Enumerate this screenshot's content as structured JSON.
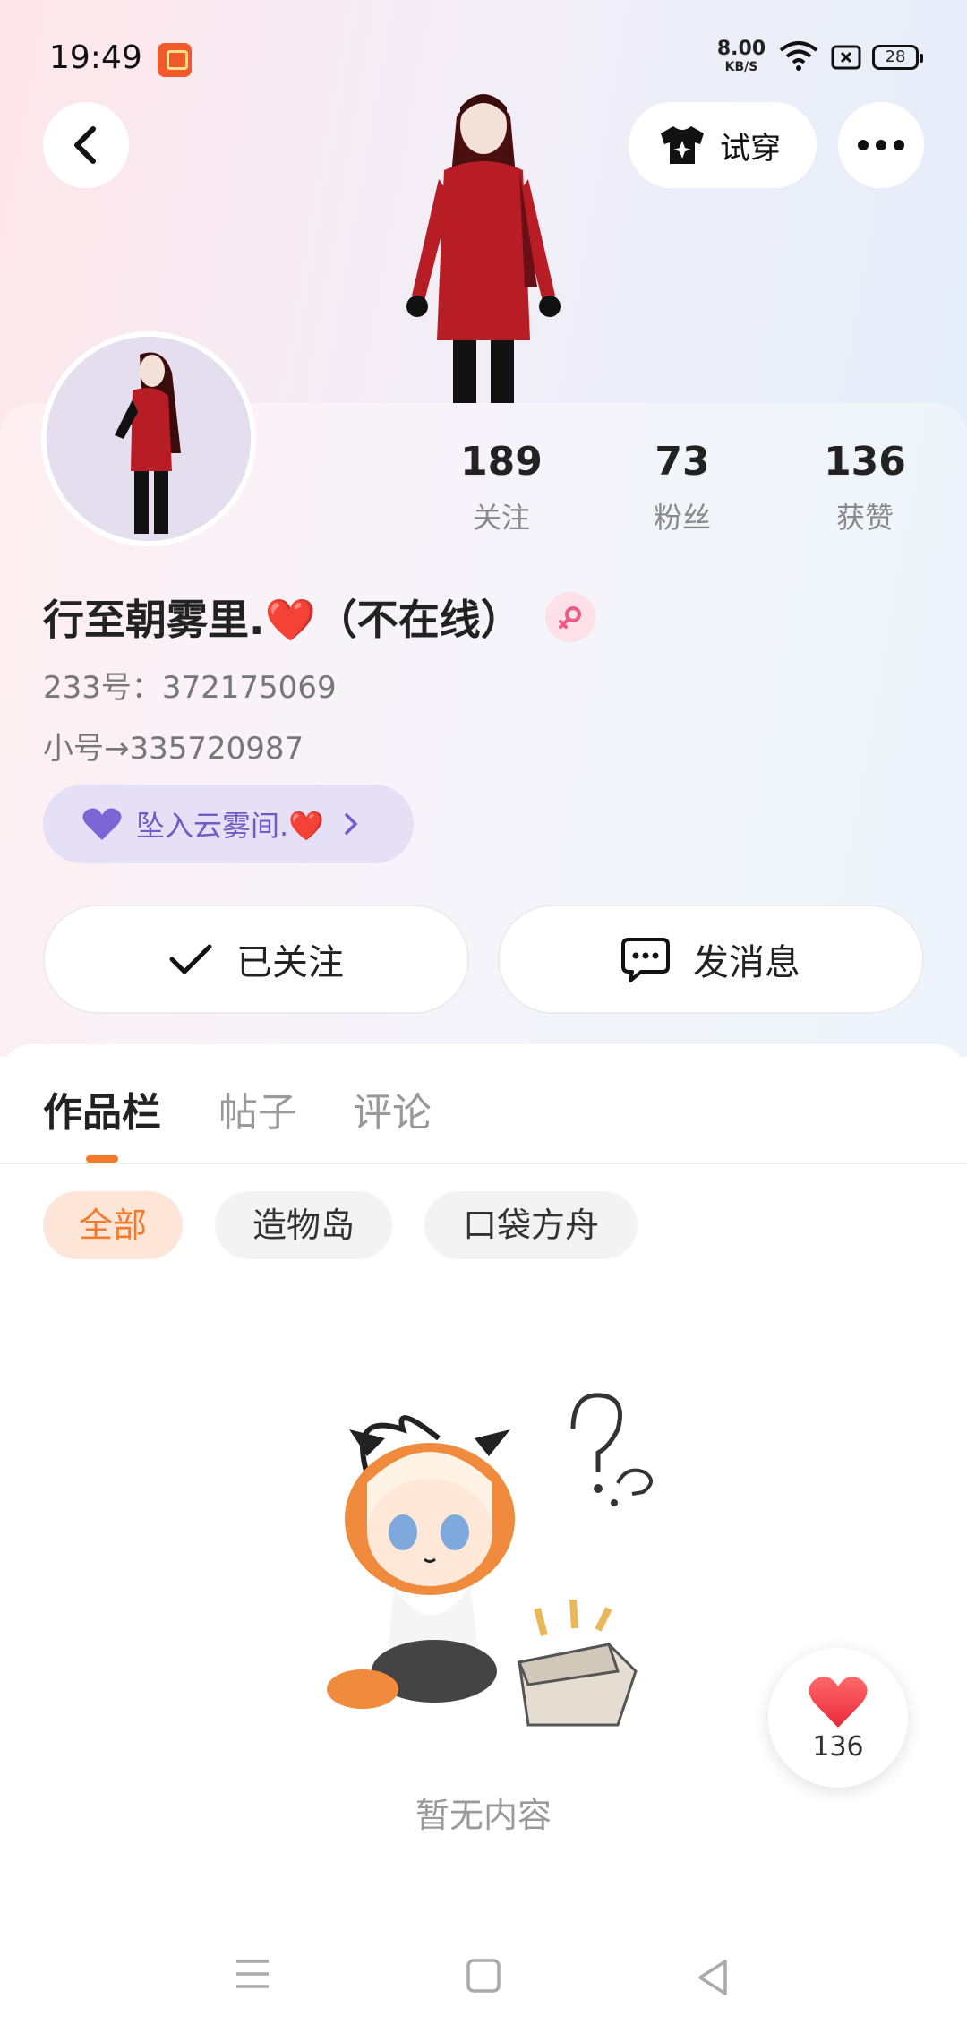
{
  "status_bar": {
    "time": "19:49",
    "net_speed_value": "8.00",
    "net_speed_unit": "KB/S",
    "battery": "28"
  },
  "header": {
    "tryon_label": "试穿"
  },
  "stats": [
    {
      "value": "189",
      "label": "关注"
    },
    {
      "value": "73",
      "label": "粉丝"
    },
    {
      "value": "136",
      "label": "获赞"
    }
  ],
  "profile": {
    "username": "行至朝雾里.❤️（不在线）",
    "id_line": "233号：372175069",
    "alt_line": "小号→335720987",
    "group_label": "坠入云雾间.❤️"
  },
  "actions": {
    "follow_label": "已关注",
    "message_label": "发消息"
  },
  "tabs": [
    {
      "label": "作品栏",
      "active": true
    },
    {
      "label": "帖子",
      "active": false
    },
    {
      "label": "评论",
      "active": false
    }
  ],
  "chips": [
    {
      "label": "全部",
      "active": true
    },
    {
      "label": "造物岛",
      "active": false
    },
    {
      "label": "口袋方舟",
      "active": false
    }
  ],
  "empty": {
    "text": "暂无内容"
  },
  "like_fab": {
    "count": "136"
  },
  "colors": {
    "accent": "#f27a2a",
    "group_pill": "#e5e0f6",
    "group_text": "#6e5cc6",
    "like_red": "#ee3b45"
  }
}
